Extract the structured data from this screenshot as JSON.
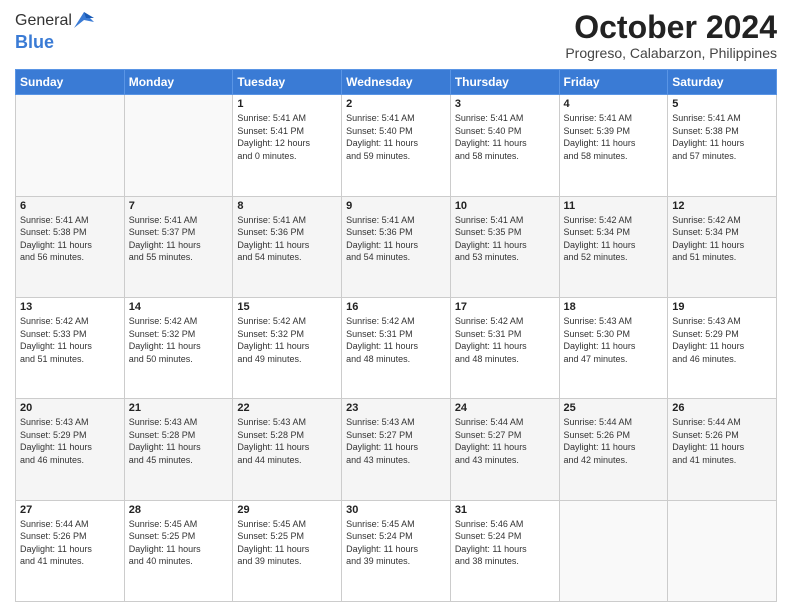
{
  "logo": {
    "line1": "General",
    "line2": "Blue"
  },
  "header": {
    "title": "October 2024",
    "location": "Progreso, Calabarzon, Philippines"
  },
  "weekdays": [
    "Sunday",
    "Monday",
    "Tuesday",
    "Wednesday",
    "Thursday",
    "Friday",
    "Saturday"
  ],
  "weeks": [
    [
      {
        "day": "",
        "info": ""
      },
      {
        "day": "",
        "info": ""
      },
      {
        "day": "1",
        "info": "Sunrise: 5:41 AM\nSunset: 5:41 PM\nDaylight: 12 hours\nand 0 minutes."
      },
      {
        "day": "2",
        "info": "Sunrise: 5:41 AM\nSunset: 5:40 PM\nDaylight: 11 hours\nand 59 minutes."
      },
      {
        "day": "3",
        "info": "Sunrise: 5:41 AM\nSunset: 5:40 PM\nDaylight: 11 hours\nand 58 minutes."
      },
      {
        "day": "4",
        "info": "Sunrise: 5:41 AM\nSunset: 5:39 PM\nDaylight: 11 hours\nand 58 minutes."
      },
      {
        "day": "5",
        "info": "Sunrise: 5:41 AM\nSunset: 5:38 PM\nDaylight: 11 hours\nand 57 minutes."
      }
    ],
    [
      {
        "day": "6",
        "info": "Sunrise: 5:41 AM\nSunset: 5:38 PM\nDaylight: 11 hours\nand 56 minutes."
      },
      {
        "day": "7",
        "info": "Sunrise: 5:41 AM\nSunset: 5:37 PM\nDaylight: 11 hours\nand 55 minutes."
      },
      {
        "day": "8",
        "info": "Sunrise: 5:41 AM\nSunset: 5:36 PM\nDaylight: 11 hours\nand 54 minutes."
      },
      {
        "day": "9",
        "info": "Sunrise: 5:41 AM\nSunset: 5:36 PM\nDaylight: 11 hours\nand 54 minutes."
      },
      {
        "day": "10",
        "info": "Sunrise: 5:41 AM\nSunset: 5:35 PM\nDaylight: 11 hours\nand 53 minutes."
      },
      {
        "day": "11",
        "info": "Sunrise: 5:42 AM\nSunset: 5:34 PM\nDaylight: 11 hours\nand 52 minutes."
      },
      {
        "day": "12",
        "info": "Sunrise: 5:42 AM\nSunset: 5:34 PM\nDaylight: 11 hours\nand 51 minutes."
      }
    ],
    [
      {
        "day": "13",
        "info": "Sunrise: 5:42 AM\nSunset: 5:33 PM\nDaylight: 11 hours\nand 51 minutes."
      },
      {
        "day": "14",
        "info": "Sunrise: 5:42 AM\nSunset: 5:32 PM\nDaylight: 11 hours\nand 50 minutes."
      },
      {
        "day": "15",
        "info": "Sunrise: 5:42 AM\nSunset: 5:32 PM\nDaylight: 11 hours\nand 49 minutes."
      },
      {
        "day": "16",
        "info": "Sunrise: 5:42 AM\nSunset: 5:31 PM\nDaylight: 11 hours\nand 48 minutes."
      },
      {
        "day": "17",
        "info": "Sunrise: 5:42 AM\nSunset: 5:31 PM\nDaylight: 11 hours\nand 48 minutes."
      },
      {
        "day": "18",
        "info": "Sunrise: 5:43 AM\nSunset: 5:30 PM\nDaylight: 11 hours\nand 47 minutes."
      },
      {
        "day": "19",
        "info": "Sunrise: 5:43 AM\nSunset: 5:29 PM\nDaylight: 11 hours\nand 46 minutes."
      }
    ],
    [
      {
        "day": "20",
        "info": "Sunrise: 5:43 AM\nSunset: 5:29 PM\nDaylight: 11 hours\nand 46 minutes."
      },
      {
        "day": "21",
        "info": "Sunrise: 5:43 AM\nSunset: 5:28 PM\nDaylight: 11 hours\nand 45 minutes."
      },
      {
        "day": "22",
        "info": "Sunrise: 5:43 AM\nSunset: 5:28 PM\nDaylight: 11 hours\nand 44 minutes."
      },
      {
        "day": "23",
        "info": "Sunrise: 5:43 AM\nSunset: 5:27 PM\nDaylight: 11 hours\nand 43 minutes."
      },
      {
        "day": "24",
        "info": "Sunrise: 5:44 AM\nSunset: 5:27 PM\nDaylight: 11 hours\nand 43 minutes."
      },
      {
        "day": "25",
        "info": "Sunrise: 5:44 AM\nSunset: 5:26 PM\nDaylight: 11 hours\nand 42 minutes."
      },
      {
        "day": "26",
        "info": "Sunrise: 5:44 AM\nSunset: 5:26 PM\nDaylight: 11 hours\nand 41 minutes."
      }
    ],
    [
      {
        "day": "27",
        "info": "Sunrise: 5:44 AM\nSunset: 5:26 PM\nDaylight: 11 hours\nand 41 minutes."
      },
      {
        "day": "28",
        "info": "Sunrise: 5:45 AM\nSunset: 5:25 PM\nDaylight: 11 hours\nand 40 minutes."
      },
      {
        "day": "29",
        "info": "Sunrise: 5:45 AM\nSunset: 5:25 PM\nDaylight: 11 hours\nand 39 minutes."
      },
      {
        "day": "30",
        "info": "Sunrise: 5:45 AM\nSunset: 5:24 PM\nDaylight: 11 hours\nand 39 minutes."
      },
      {
        "day": "31",
        "info": "Sunrise: 5:46 AM\nSunset: 5:24 PM\nDaylight: 11 hours\nand 38 minutes."
      },
      {
        "day": "",
        "info": ""
      },
      {
        "day": "",
        "info": ""
      }
    ]
  ]
}
